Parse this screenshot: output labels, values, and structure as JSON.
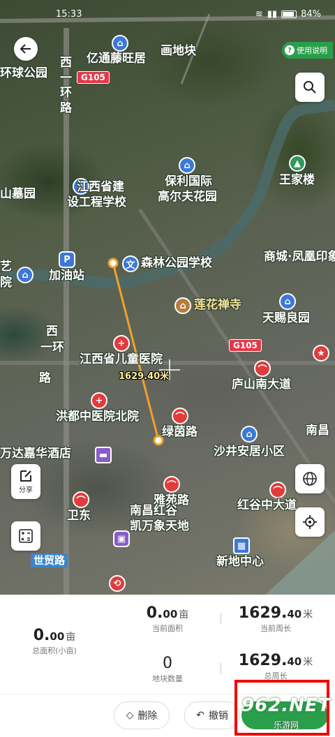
{
  "status": {
    "time": "15:33",
    "battery": "84%"
  },
  "toolbar": {
    "help_label": "使用说明",
    "share_label": "分享"
  },
  "map_labels": {
    "park": "环球公园",
    "g105_top": "G105",
    "g105_right": "G105",
    "yitong": "亿通藤旺居",
    "huadikuai": "画地块",
    "xi1": "西",
    "xi2": "一",
    "xi3": "环",
    "xi4": "路",
    "baoli1": "保利国际",
    "baoli2": "高尔夫花园",
    "jiangxi1": "江西省建",
    "jiangxi2": "设工程学校",
    "shanmu": "山墓园",
    "wangjialou": "王家楼",
    "shangcheng": "商城·凤凰印象",
    "senlin": "森林公园学校",
    "jiayouzhan": "加油站",
    "lianhua": "莲花禅寺",
    "tianci": "天赐良园",
    "ertong": "江西省儿童医院",
    "lushan": "庐山南大道",
    "hongdu": "洪都中医院北院",
    "lvyin": "绿茵路",
    "shajing": "沙井安居小区",
    "wanda": "万达嘉华酒店",
    "nanchang_r": "南昌",
    "weidong": "卫东",
    "yayuan": "雅苑路",
    "honggu": "红谷中大道",
    "nanchang1": "南昌红谷",
    "nanchang2": "凯万象天地",
    "shimao": "世贸路",
    "xindi": "新地中心",
    "yuan": "院",
    "xi5": "西",
    "xi6": "一环",
    "xi7": "路",
    "jie": "艺",
    "road_top": "庐山南大道"
  },
  "measure": {
    "distance_label": "1629.40米"
  },
  "stats": {
    "current_area": {
      "int": "0.",
      "dec": "00",
      "unit": "亩",
      "label": "当前面积"
    },
    "current_perimeter": {
      "int": "1629.",
      "dec": "40",
      "unit": "米",
      "label": "当前周长"
    },
    "total_area": {
      "int": "0.",
      "dec": "00",
      "unit": "亩",
      "label": "总面积(小亩)"
    },
    "plot_count": {
      "value": "0",
      "label": "地块数量"
    },
    "total_perimeter": {
      "int": "1629.",
      "dec": "40",
      "unit": "米",
      "label": "总周长"
    }
  },
  "actions": {
    "delete_label": "删除",
    "undo_label": "撤销"
  },
  "watermark": {
    "brand": "962.NET",
    "sub": "乐游网"
  }
}
